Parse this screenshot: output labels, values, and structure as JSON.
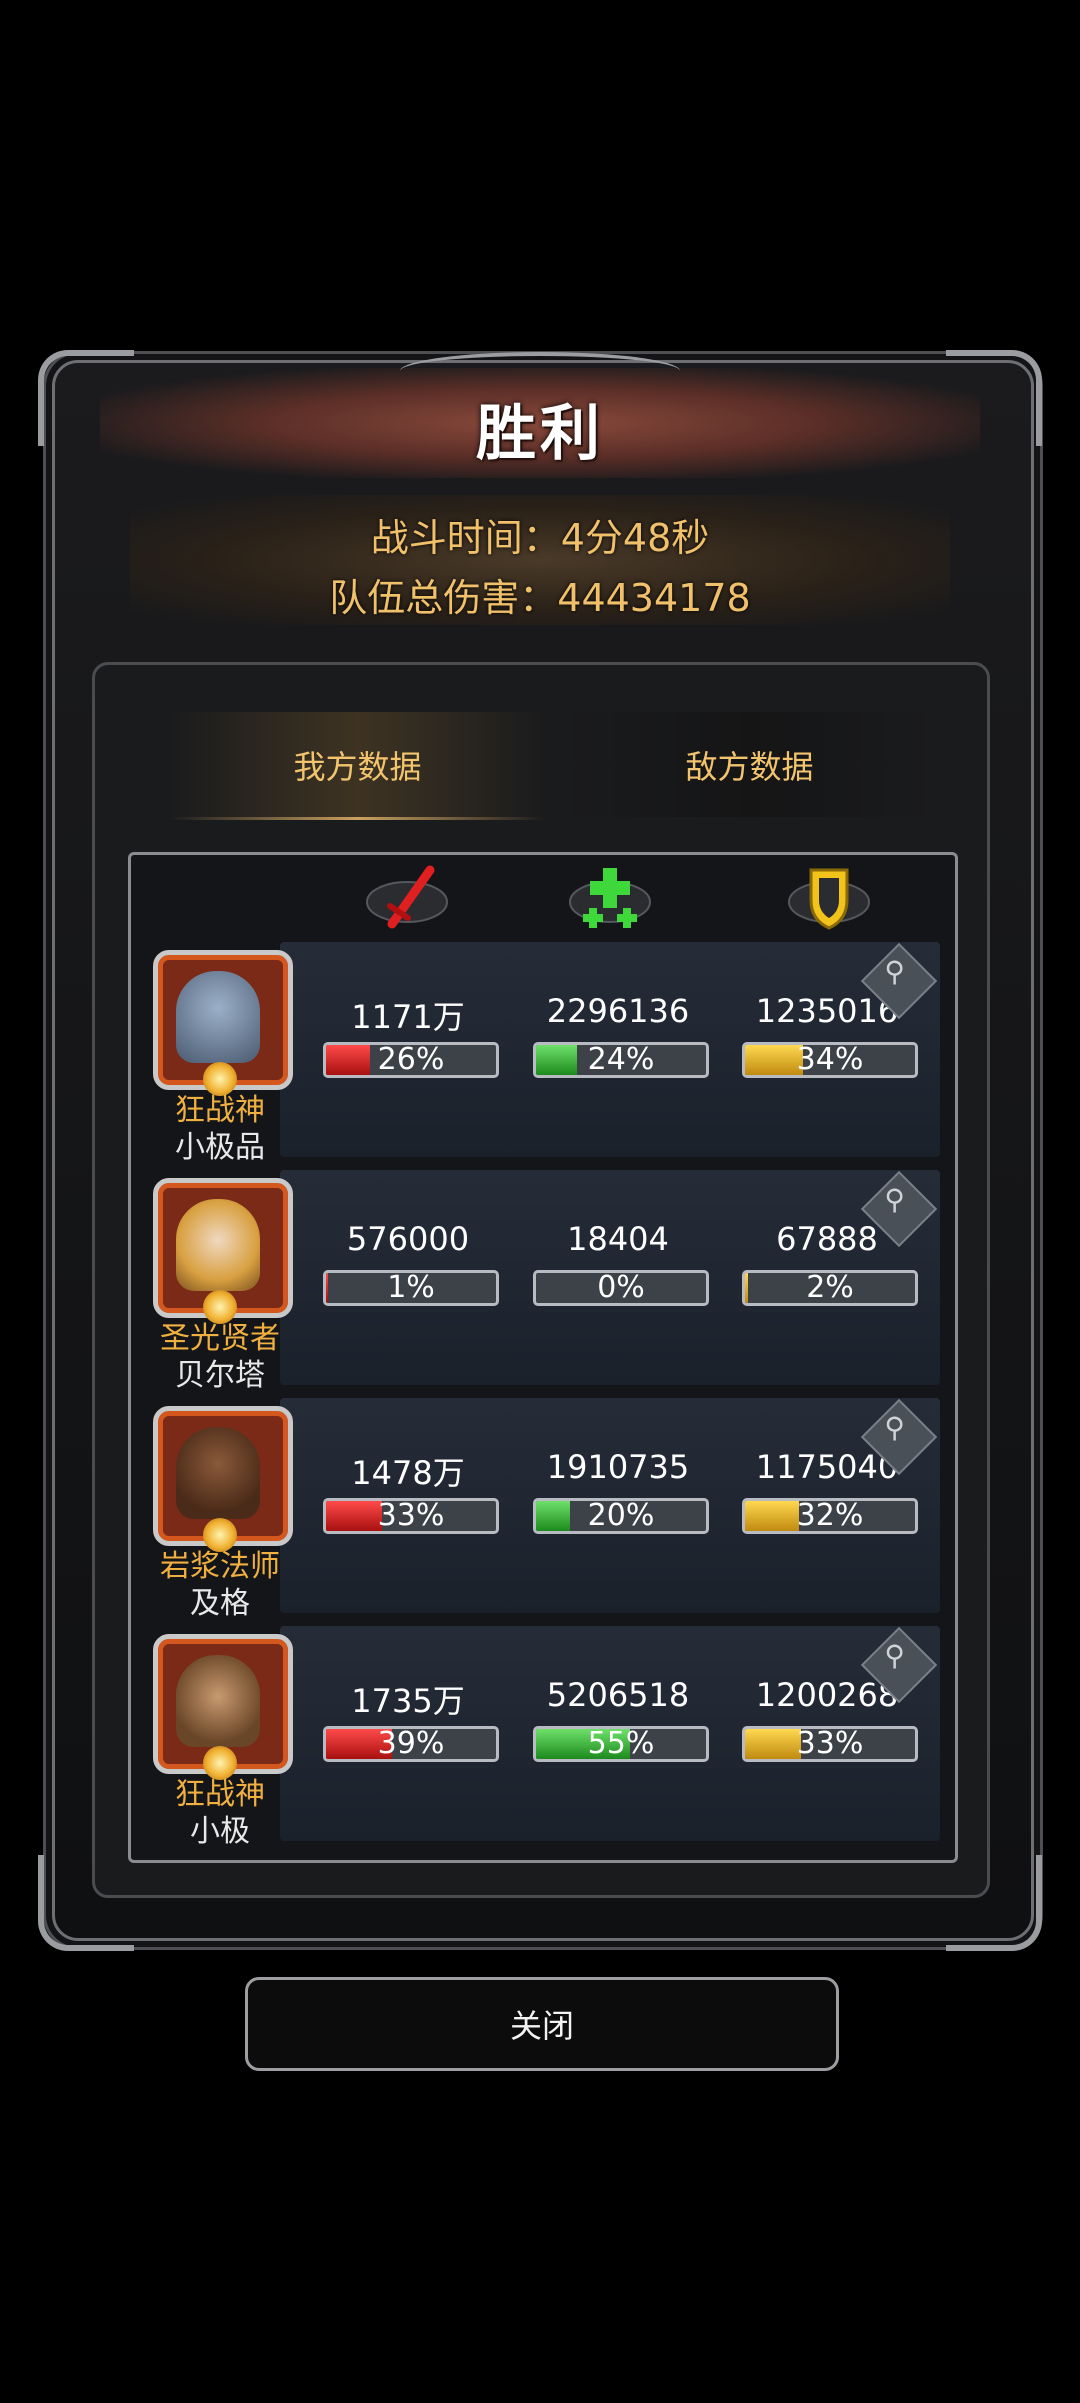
{
  "header": {
    "title": "胜利",
    "battle_time": "战斗时间：4分48秒",
    "team_damage": "队伍总伤害：44434178"
  },
  "tabs": [
    {
      "label": "我方数据",
      "active": true
    },
    {
      "label": "敌方数据",
      "active": false
    }
  ],
  "column_icons": [
    "sword-icon",
    "heal-cross-icon",
    "shield-icon"
  ],
  "heroes": [
    {
      "class": "狂战神",
      "name": "小极品",
      "damage": "1171万",
      "damage_pct": "26%",
      "damage_frac": 0.26,
      "heal": "2296136",
      "heal_pct": "24%",
      "heal_frac": 0.24,
      "tank": "1235016",
      "tank_pct": "34%",
      "tank_frac": 0.34
    },
    {
      "class": "圣光贤者",
      "name": "贝尔塔",
      "damage": "576000",
      "damage_pct": "1%",
      "damage_frac": 0.01,
      "heal": "18404",
      "heal_pct": "0%",
      "heal_frac": 0.0,
      "tank": "67888",
      "tank_pct": "2%",
      "tank_frac": 0.02
    },
    {
      "class": "岩浆法师",
      "name": "及格",
      "damage": "1478万",
      "damage_pct": "33%",
      "damage_frac": 0.33,
      "heal": "1910735",
      "heal_pct": "20%",
      "heal_frac": 0.2,
      "tank": "1175040",
      "tank_pct": "32%",
      "tank_frac": 0.32
    },
    {
      "class": "狂战神",
      "name": "小极",
      "damage": "1735万",
      "damage_pct": "39%",
      "damage_frac": 0.39,
      "heal": "5206518",
      "heal_pct": "55%",
      "heal_frac": 0.55,
      "tank": "1200268",
      "tank_pct": "33%",
      "tank_frac": 0.33
    }
  ],
  "close_label": "关闭",
  "colors": {
    "gold": "#f3c46e",
    "damage": "#c81818",
    "heal": "#2aa02a",
    "tank": "#e0a820"
  }
}
